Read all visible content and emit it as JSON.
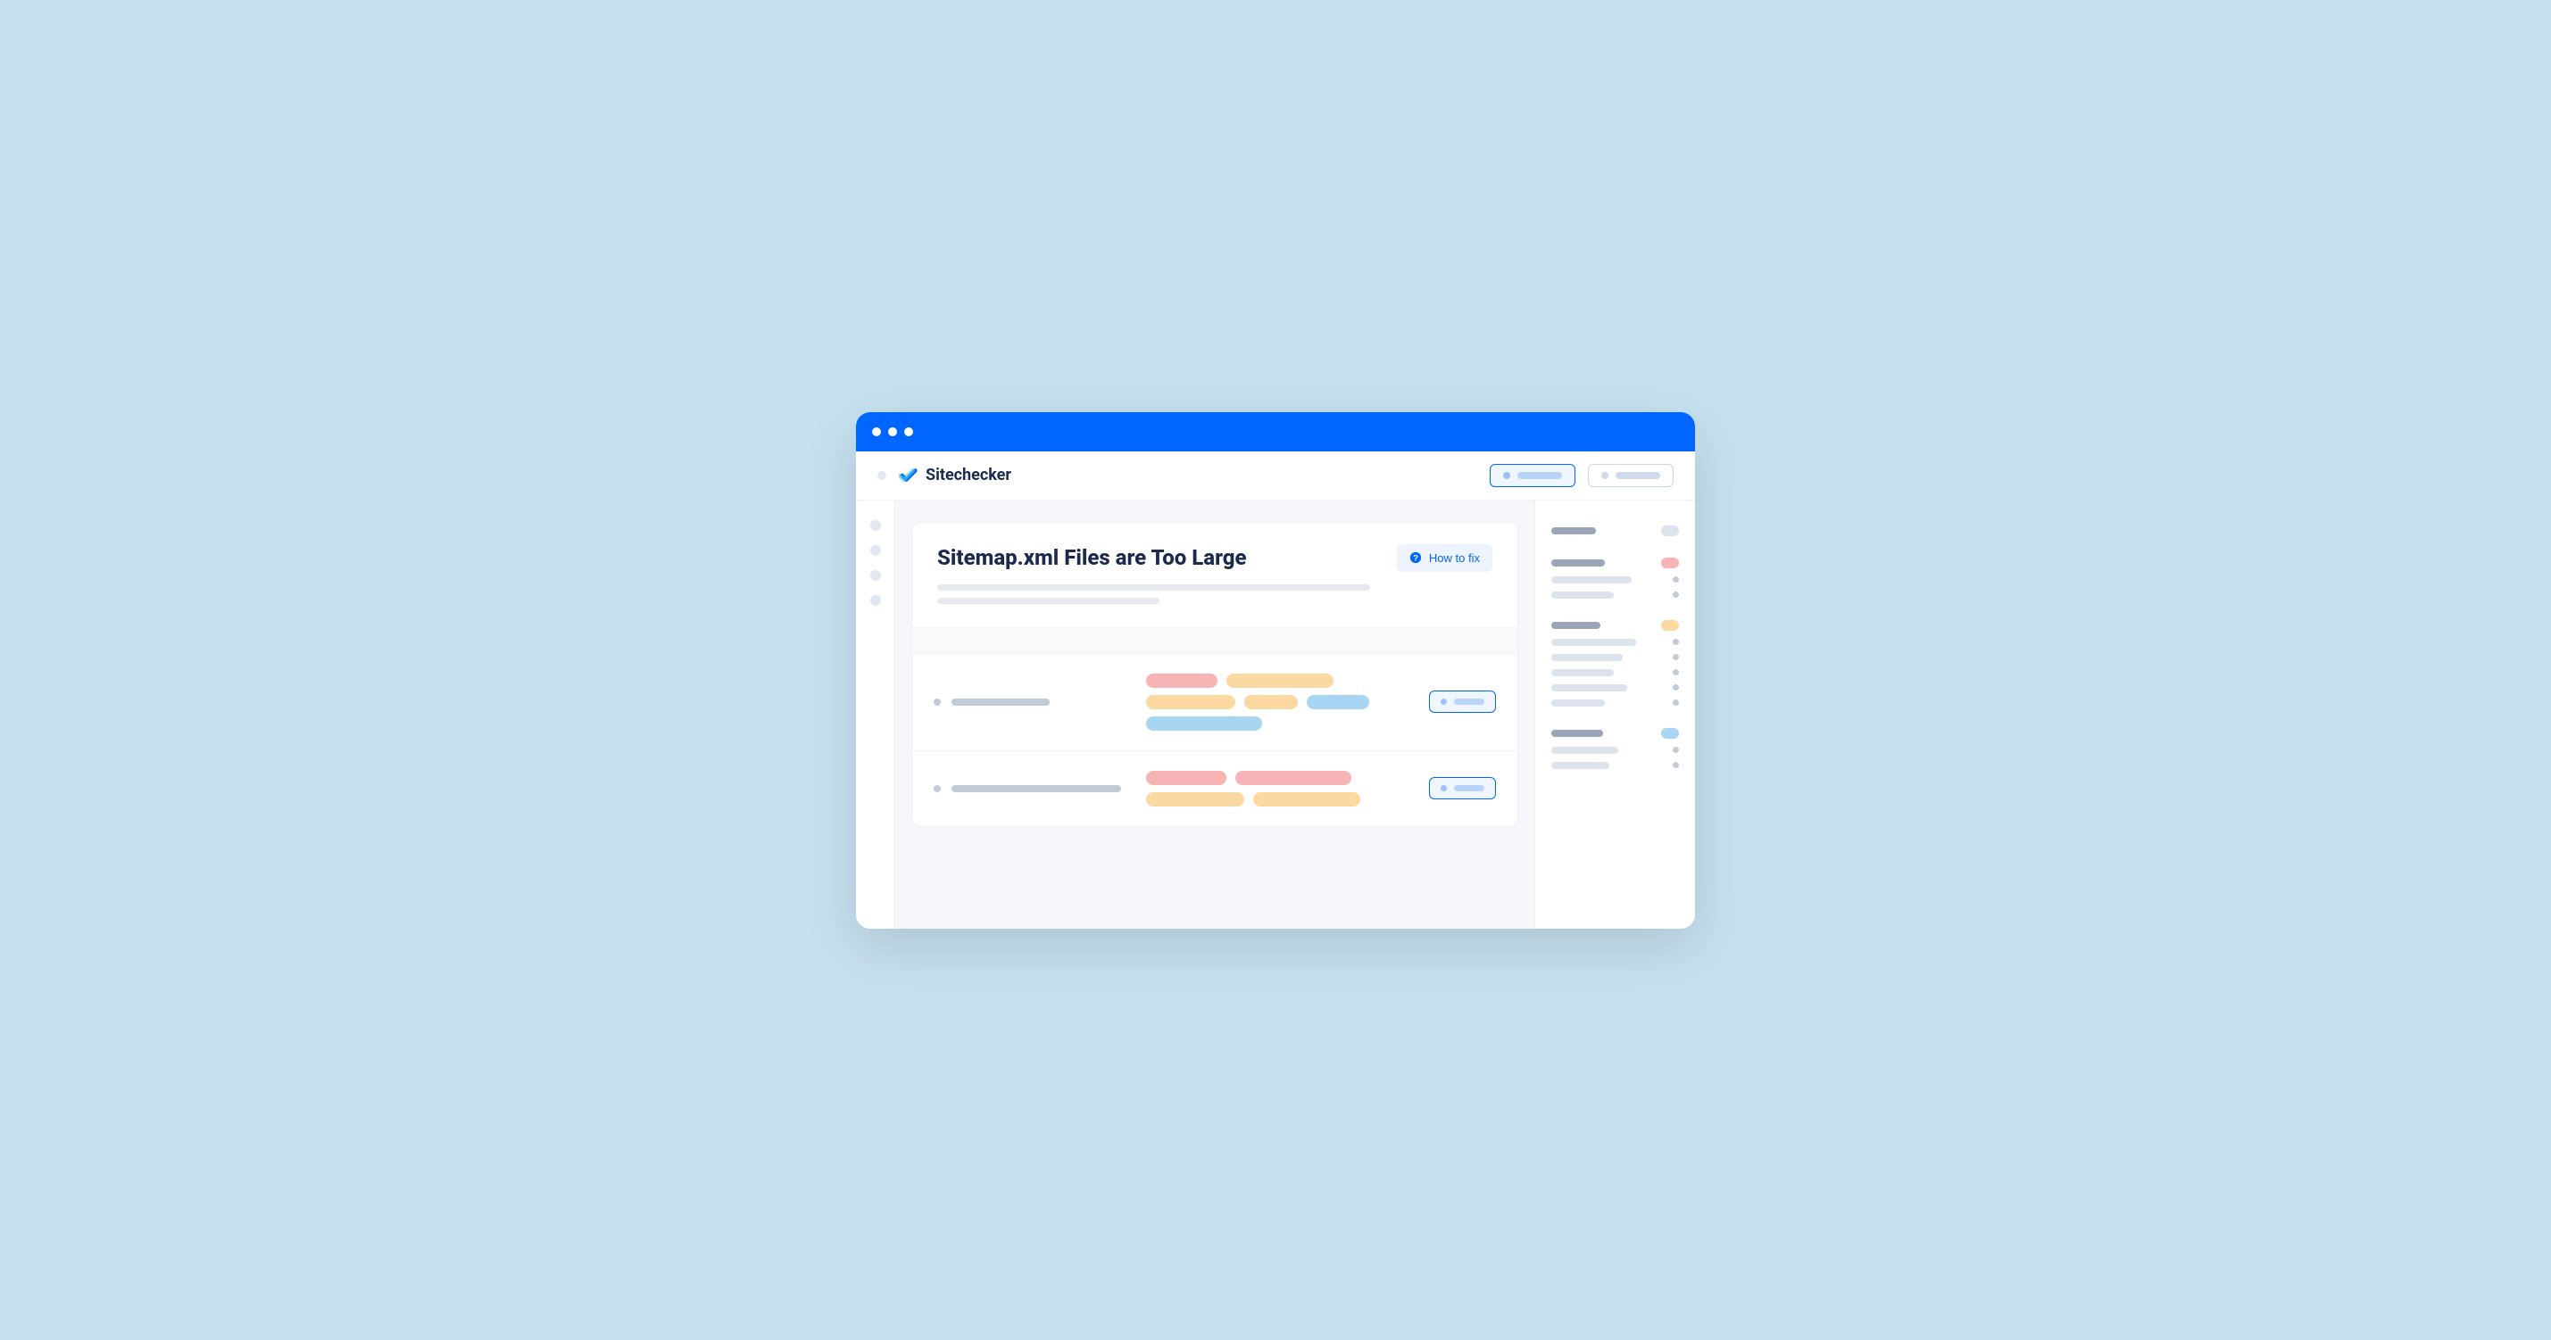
{
  "brand": {
    "name": "Sitechecker"
  },
  "page": {
    "title": "Sitemap.xml Files are Too Large",
    "howToFixLabel": "How to fix"
  }
}
